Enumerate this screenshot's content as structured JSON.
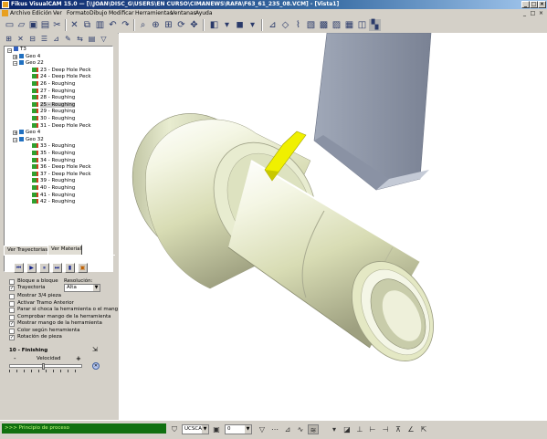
{
  "window": {
    "title": "Fikus VisualCAM 15.0 — [\\\\JOAN\\DISC_G\\USERS\\EN CURSO\\CIMANEWS\\RAFA\\F63_61_235_08.VCM] - [Vista1]",
    "controls": [
      "_",
      "□",
      "×"
    ]
  },
  "menu": [
    "Archivo",
    "Edición",
    "Ver",
    "Formato",
    "Dibujo",
    "Modificar",
    "Herramientas",
    "Ventanas",
    "Ayuda"
  ],
  "mdi_controls": [
    "_",
    "□",
    "×"
  ],
  "toolbar_icons": [
    "new-icon",
    "open-icon",
    "save-icon",
    "print-icon",
    "cut-icon",
    "copy-icon",
    "paste-icon",
    "undo-icon",
    "redo-icon",
    "select-icon",
    "delete-icon",
    "rotate-icon",
    "zoom-icon",
    "zoom-window-icon",
    "fit-icon",
    "pan-icon",
    "shade-icon",
    "view-icon",
    "layer-icon",
    "measure-icon",
    "isometric-icon",
    "toolpath-icon",
    "cube-icon",
    "tool-icon"
  ],
  "tree": {
    "root": "T3",
    "items": [
      {
        "label": "Geo 4",
        "level": 1,
        "type": "geo"
      },
      {
        "label": "Geo 22",
        "level": 1,
        "type": "geo",
        "expanded": true
      },
      {
        "label": "23 - Deep Hole Peck",
        "level": 2
      },
      {
        "label": "24 - Deep Hole Peck",
        "level": 2
      },
      {
        "label": "26 - Roughing",
        "level": 2
      },
      {
        "label": "27 - Roughing",
        "level": 2
      },
      {
        "label": "28 - Roughing",
        "level": 2
      },
      {
        "label": "25 - Roughing",
        "level": 2,
        "selected": true
      },
      {
        "label": "29 - Roughing",
        "level": 2
      },
      {
        "label": "30 - Roughing",
        "level": 2
      },
      {
        "label": "31 - Deep Hole Peck",
        "level": 2
      },
      {
        "label": "Geo 4",
        "level": 1,
        "type": "geo"
      },
      {
        "label": "Geo 32",
        "level": 1,
        "type": "geo",
        "expanded": true
      },
      {
        "label": "33 - Roughing",
        "level": 2
      },
      {
        "label": "35 - Roughing",
        "level": 2
      },
      {
        "label": "34 - Roughing",
        "level": 2
      },
      {
        "label": "36 - Deep Hole Peck",
        "level": 2
      },
      {
        "label": "37 - Deep Hole Peck",
        "level": 2
      },
      {
        "label": "39 - Roughing",
        "level": 2
      },
      {
        "label": "40 - Roughing",
        "level": 2
      },
      {
        "label": "41 - Roughing",
        "level": 2
      },
      {
        "label": "42 - Roughing",
        "level": 2
      }
    ]
  },
  "tabs": [
    {
      "label": "Ver Trayectorias",
      "active": false
    },
    {
      "label": "Ver Material",
      "active": true
    }
  ],
  "playback_buttons": [
    "⏮",
    "▶",
    "⏸",
    "⏭",
    "▮"
  ],
  "options": {
    "bloque": {
      "label": "Bloque a bloque",
      "checked": false
    },
    "trayectoria": {
      "label": "Trayectoria",
      "checked": true
    },
    "resolucion_label": "Resolución:",
    "resolucion_value": "Alta",
    "list": [
      {
        "label": "Mostrar 3/4 pieza",
        "checked": false
      },
      {
        "label": "Activar Tramo Anterior",
        "checked": false
      },
      {
        "label": "Parar si choca la herramienta o el mang",
        "checked": false
      },
      {
        "label": "Comprobar mango de la herramienta",
        "checked": false
      },
      {
        "label": "Mostrar mango de la herramienta",
        "checked": true
      },
      {
        "label": "Color según herramienta",
        "checked": false
      },
      {
        "label": "Rotación de pieza",
        "checked": true
      }
    ]
  },
  "operation": "10 - Finishing",
  "speed": {
    "label": "Velocidad",
    "minus": "-",
    "plus": "+",
    "level": 0.45
  },
  "status": {
    "message": ">>> Principio de proceso",
    "ucs_value": "UCSCAM",
    "layer_value": "0"
  },
  "colors": {
    "accent": "#0a246a",
    "status_bg": "#107010",
    "part_body": "#e4e8c4",
    "insert": "#f0f000",
    "holder": "#9098a8"
  }
}
